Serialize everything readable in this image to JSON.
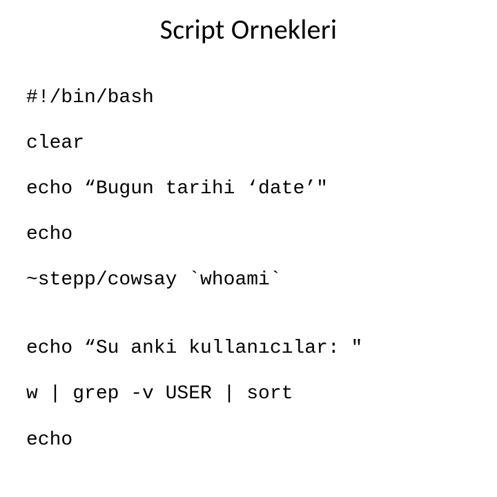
{
  "title": "Script Ornekleri",
  "code": {
    "l1": "#!/bin/bash",
    "l2": "clear",
    "l3": "echo “Bugun tarihi ‘date’\"",
    "l4": "echo",
    "l5": "~stepp/cowsay `whoami`",
    "l6": "",
    "l7": "echo “Su anki kullanıcılar: \"",
    "l8": "w | grep -v USER | sort",
    "l9": "echo"
  }
}
